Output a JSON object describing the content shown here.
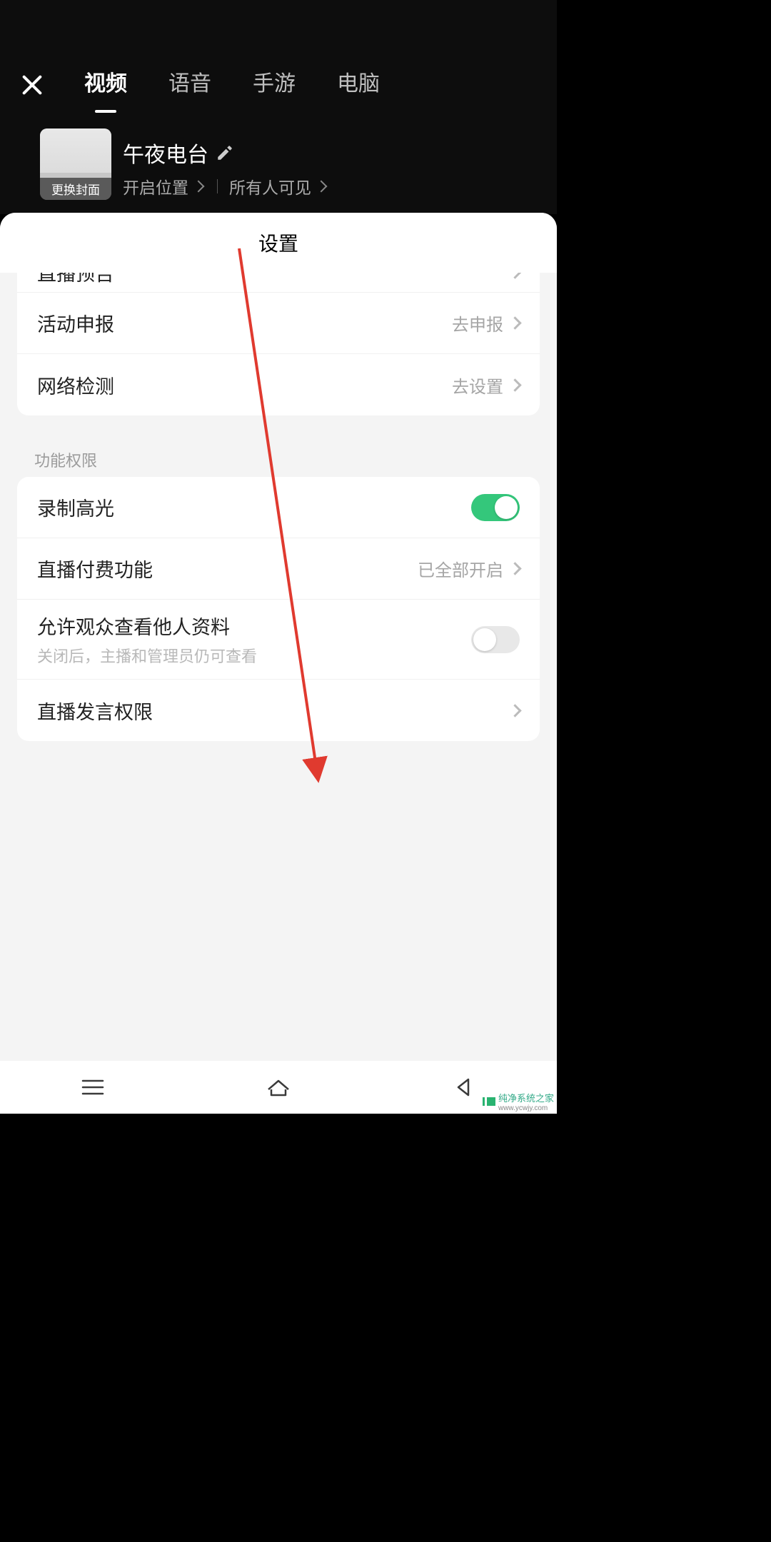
{
  "header": {
    "tabs": [
      "视频",
      "语音",
      "手游",
      "电脑"
    ],
    "active_tab": 0,
    "cover_label": "更换封面",
    "room_title": "午夜电台",
    "location_label": "开启位置",
    "visibility_label": "所有人可见"
  },
  "sheet": {
    "title": "设置",
    "group1": [
      {
        "label": "直播预告",
        "value": ""
      },
      {
        "label": "活动申报",
        "value": "去申报"
      },
      {
        "label": "网络检测",
        "value": "去设置"
      }
    ],
    "section_header": "功能权限",
    "group2": {
      "highlight": {
        "label": "录制高光",
        "on": true
      },
      "paid": {
        "label": "直播付费功能",
        "value": "已全部开启"
      },
      "viewprofile": {
        "label": "允许观众查看他人资料",
        "desc": "关闭后，主播和管理员仍可查看",
        "on": false
      },
      "speak": {
        "label": "直播发言权限"
      }
    }
  },
  "watermark": {
    "text": "纯净系统之家",
    "url": "www.ycwjy.com"
  }
}
